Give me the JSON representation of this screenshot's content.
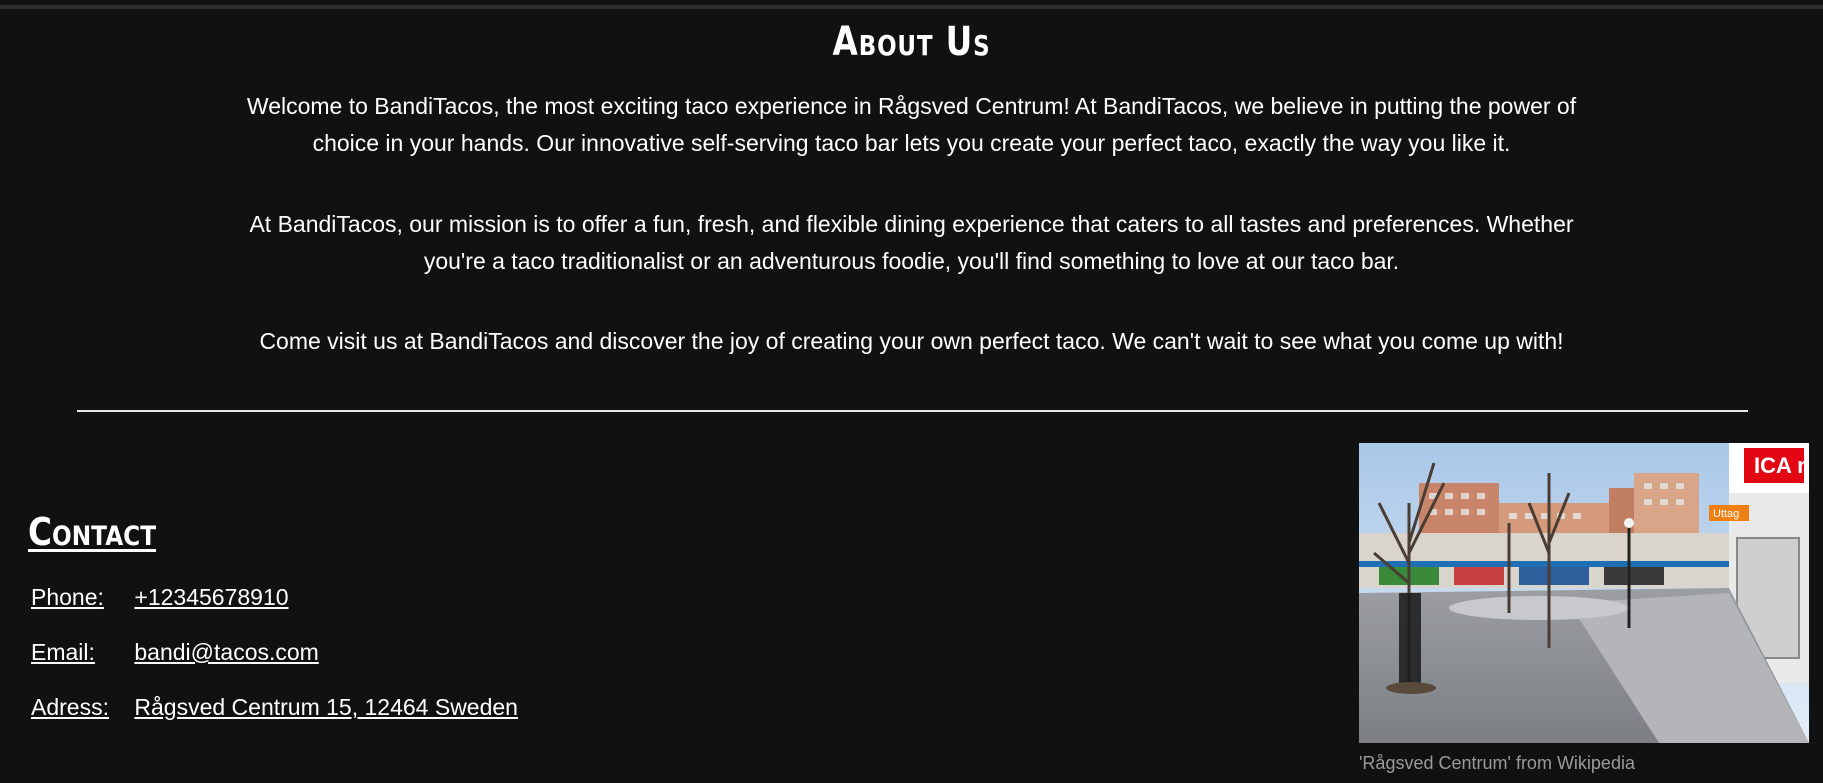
{
  "about": {
    "title": "About Us",
    "paragraphs": [
      "Welcome to BandiTacos, the most exciting taco experience in Rågsved Centrum! At BandiTacos, we believe in putting the power of choice in your hands. Our innovative self-serving taco bar lets you create your perfect taco, exactly the way you like it.",
      "At BandiTacos, our mission is to offer a fun, fresh, and flexible dining experience that caters to all tastes and preferences. Whether you're a taco traditionalist or an adventurous foodie, you'll find something to love at our taco bar.",
      "Come visit us at BandiTacos and discover the joy of creating your own perfect taco. We can't wait to see what you come up with!"
    ]
  },
  "contact": {
    "title": "Contact",
    "phone_label": "Phone:",
    "phone_value": "+12345678910",
    "email_label": "Email:",
    "email_value": "bandi@tacos.com",
    "address_label": "Adress:",
    "address_value": "Rågsved Centrum 15, 12464 Sweden"
  },
  "photo": {
    "caption": "'Rågsved Centrum' from Wikipedia",
    "sign_text": "Uttag",
    "store_text": "ICA nä"
  },
  "colors": {
    "background": "#111111",
    "text": "#ffffff",
    "caption": "#9a9a9a"
  }
}
